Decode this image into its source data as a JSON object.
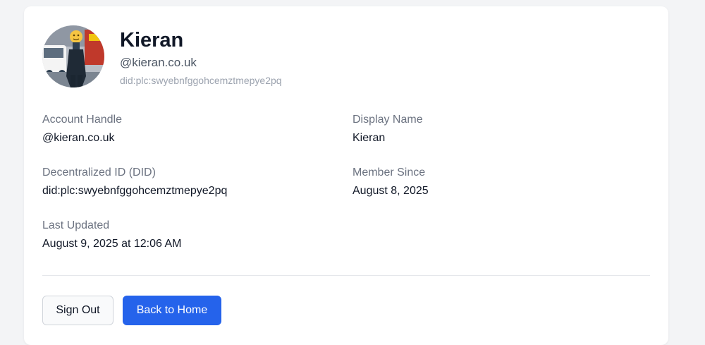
{
  "profile": {
    "name": "Kieran",
    "handle": "@kieran.co.uk",
    "did": "did:plc:swyebnfggohcemztmepye2pq"
  },
  "fields": {
    "account_handle": {
      "label": "Account Handle",
      "value": "@kieran.co.uk"
    },
    "display_name": {
      "label": "Display Name",
      "value": "Kieran"
    },
    "did": {
      "label": "Decentralized ID (DID)",
      "value": "did:plc:swyebnfggohcemztmepye2pq"
    },
    "member_since": {
      "label": "Member Since",
      "value": "August 8, 2025"
    },
    "last_updated": {
      "label": "Last Updated",
      "value": "August 9, 2025 at 12:06 AM"
    }
  },
  "actions": {
    "sign_out": "Sign Out",
    "back_home": "Back to Home"
  },
  "colors": {
    "primary": "#2563eb",
    "muted_text": "#6b7280",
    "page_bg": "#f3f4f6"
  }
}
